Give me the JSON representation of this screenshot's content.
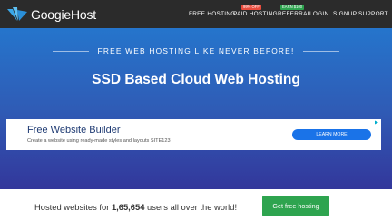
{
  "brand": {
    "name": "GoogieHost",
    "icon": "wing-logo-icon"
  },
  "nav": {
    "items": [
      {
        "label": "FREE HOSTING",
        "badge": null
      },
      {
        "label": "PAID HOSTING",
        "badge": "99% OFF"
      },
      {
        "label": "REFERRAL",
        "badge": "EARN $100"
      },
      {
        "label": "LOGIN",
        "badge": null
      },
      {
        "label": "SIGNUP",
        "badge": null
      },
      {
        "label": "SUPPORT",
        "badge": null
      }
    ]
  },
  "hero": {
    "tagline": "FREE WEB HOSTING LIKE NEVER BEFORE!",
    "title": "SSD Based Cloud Web Hosting"
  },
  "ad": {
    "headline": "Free Website Builder",
    "description": "Create a website using ready-made styles and layouts SITE123",
    "cta": "LEARN MORE",
    "icon": "ad-choices-icon"
  },
  "stats": {
    "prefix": "Hosted websites for ",
    "count": "1,65,654",
    "suffix": " users all over the world!"
  },
  "cta": {
    "label": "Get free hosting"
  },
  "colors": {
    "navbar": "#2b2b2b",
    "hero_top": "#2575cc",
    "hero_bottom": "#33379b",
    "badge_paid": "#e84c3d",
    "badge_referral": "#2ea44f",
    "ad_button": "#1a73e8",
    "cta": "#2ea44f"
  }
}
